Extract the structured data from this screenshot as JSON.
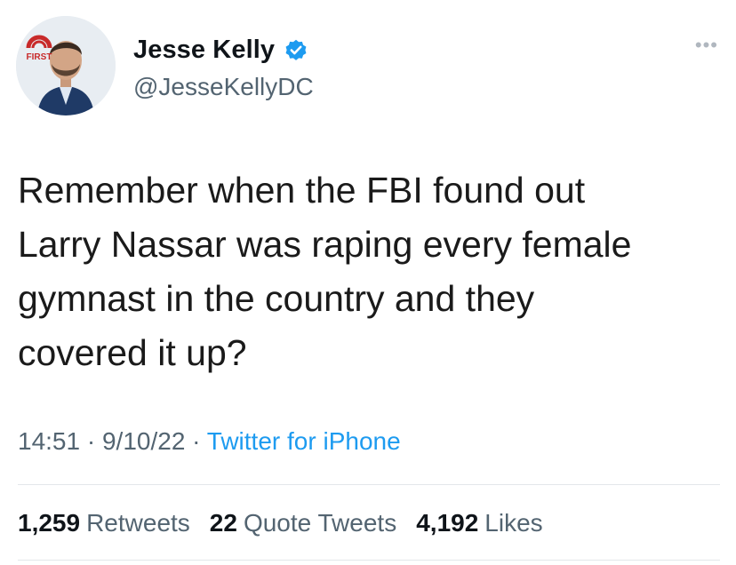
{
  "user": {
    "display_name": "Jesse Kelly",
    "handle": "@JesseKellyDC",
    "verified": true,
    "avatar_badge_text": "FIRST"
  },
  "menu_icon": "more-dots",
  "tweet": {
    "text": "Remember when the FBI found out\nLarry Nassar was raping every female\ngymnast in the country and they\ncovered it up?",
    "time": "14:51",
    "date": "9/10/22",
    "source": "Twitter for iPhone"
  },
  "stats": {
    "retweets_count": "1,259",
    "retweets_label": "Retweets",
    "quotes_count": "22",
    "quotes_label": "Quote Tweets",
    "likes_count": "4,192",
    "likes_label": "Likes"
  },
  "colors": {
    "link": "#1d9bf0",
    "secondary": "#536471",
    "verified": "#1d9bf0"
  }
}
